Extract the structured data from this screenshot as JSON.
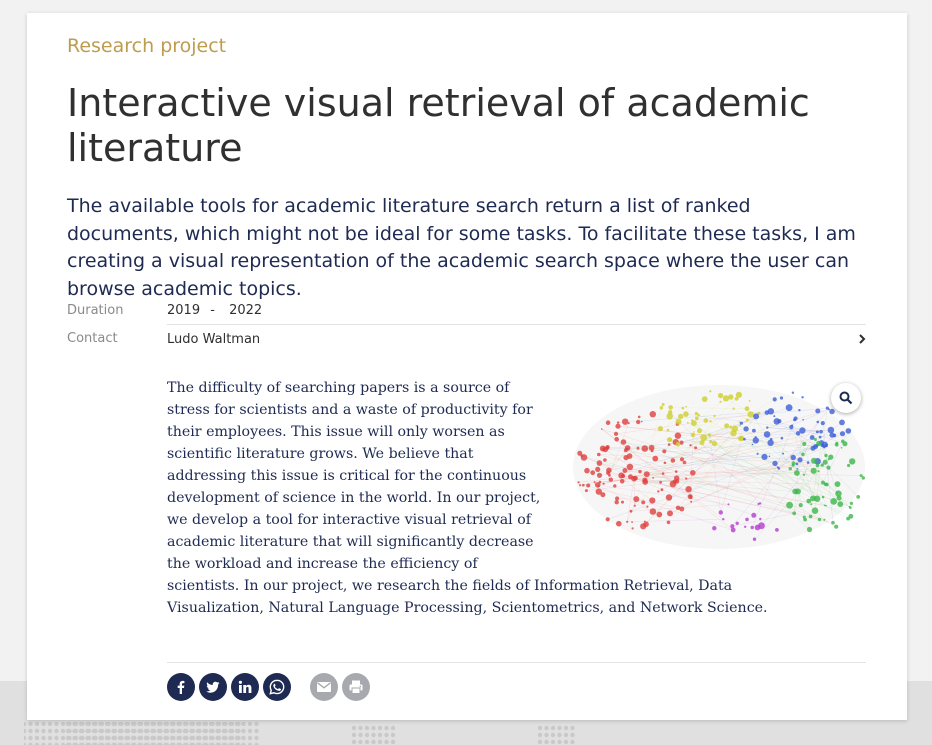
{
  "page": {
    "kicker": "Research project",
    "title": "Interactive visual retrieval of academic literature",
    "summary": "The available tools for academic literature search return a list of ranked documents, which might not be ideal for some tasks. To facilitate these tasks, I am creating a visual representation of the academic search space where the user can browse academic topics."
  },
  "meta": {
    "duration_label": "Duration",
    "start_year": "2019",
    "separator": "-",
    "end_year": "2022",
    "contact_label": "Contact",
    "contact_name": "Ludo Waltman"
  },
  "body": {
    "text": "The difficulty of searching papers is a source of stress for scientists and a waste of productivity for their employees. This issue will only worsen as scientific literature grows. We believe that addressing this issue is critical for the continuous development of science in the world. In our project, we develop a tool for interactive visual retrieval of academic literature that will significantly decrease the workload and increase the efficiency of scientists. In our project, we research the fields of Information Retrieval, Data Visualization, Natural Language Processing, Scientometrics, and Network Science."
  },
  "figure": {
    "cluster_colors": [
      "#e0403f",
      "#cfcf2e",
      "#3d5fd8",
      "#3cb84a",
      "#b53dd0"
    ],
    "icon": "magnifier-icon"
  },
  "share": {
    "icons": [
      "facebook-icon",
      "twitter-icon",
      "linkedin-icon",
      "whatsapp-icon",
      "email-icon",
      "print-icon"
    ],
    "social_color": "#1e2a52",
    "utility_color": "#a7a9ae"
  },
  "theme": {
    "accent": "#be9c4f",
    "text_dark": "#303030",
    "navy": "#1e2a52"
  }
}
